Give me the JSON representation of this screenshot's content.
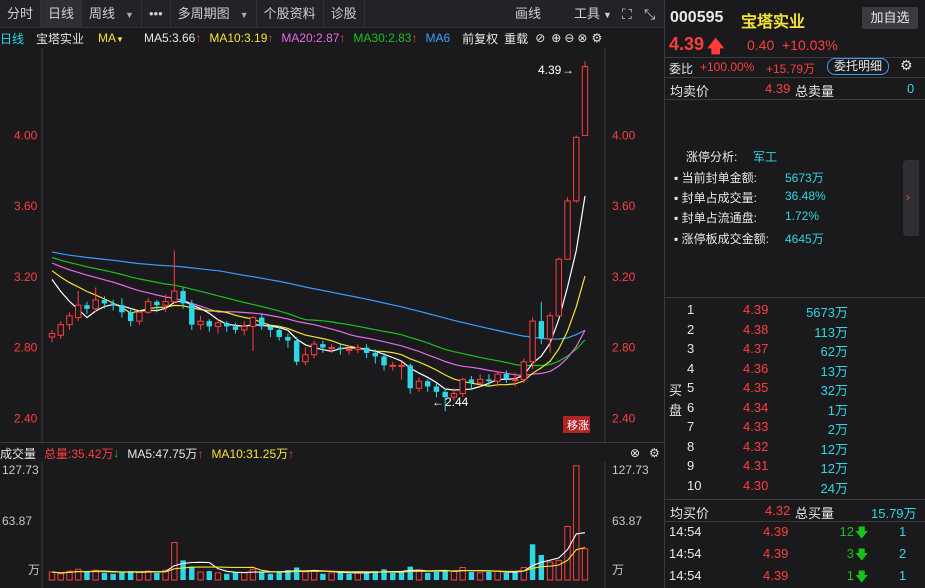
{
  "toolbar": {
    "items": [
      "分时",
      "日线",
      "周线",
      "•••",
      "多周期图",
      "个股资料",
      "诊股"
    ],
    "right_items": [
      "画线",
      "工具"
    ]
  },
  "chart_header": {
    "period": "日线",
    "name": "宝塔实业",
    "ma_label": "MA",
    "ma5": "MA5:3.66",
    "ma10": "MA10:3.19",
    "ma20": "MA20:2.87",
    "ma30": "MA30:2.83",
    "ma60": "MA6",
    "adjust": "前复权",
    "overlay": "重载"
  },
  "volume_header": {
    "label": "成交量",
    "total": "总量:35.42万",
    "ma5": "MA5:47.75万",
    "ma10": "MA10:31.25万"
  },
  "axis": {
    "price_ticks": [
      "4.00",
      "3.60",
      "3.20",
      "2.80",
      "2.40"
    ],
    "volume_ticks": [
      "127.73",
      "63.87"
    ],
    "volume_unit": "万"
  },
  "annotations": {
    "high": "4.39",
    "low": "2.44",
    "badge": "移涨"
  },
  "colors": {
    "up": "#ff3d3d",
    "down": "#2ed7e5",
    "ma5": "#ffffff",
    "ma10": "#f5e431",
    "ma20": "#e868e8",
    "ma30": "#19c219",
    "ma60": "#3d9bff"
  },
  "chart_data": {
    "type": "candlestick",
    "ylim": [
      2.3,
      4.45
    ],
    "candles": [
      [
        2.86,
        2.88,
        2.83,
        2.9
      ],
      [
        2.87,
        2.93,
        2.85,
        2.95
      ],
      [
        2.93,
        2.98,
        2.9,
        3.0
      ],
      [
        2.97,
        3.04,
        2.95,
        3.12
      ],
      [
        3.04,
        3.02,
        2.99,
        3.06
      ],
      [
        3.02,
        3.07,
        3.0,
        3.14
      ],
      [
        3.07,
        3.05,
        3.02,
        3.09
      ],
      [
        3.05,
        3.04,
        3.01,
        3.07
      ],
      [
        3.04,
        3.0,
        2.97,
        3.08
      ],
      [
        3.0,
        2.95,
        2.92,
        3.02
      ],
      [
        2.95,
        3.0,
        2.93,
        3.01
      ],
      [
        3.0,
        3.06,
        2.99,
        3.08
      ],
      [
        3.06,
        3.04,
        3.0,
        3.07
      ],
      [
        3.04,
        3.06,
        3.0,
        3.1
      ],
      [
        3.06,
        3.12,
        3.05,
        3.35
      ],
      [
        3.12,
        3.05,
        3.02,
        3.14
      ],
      [
        3.05,
        2.93,
        2.9,
        3.07
      ],
      [
        2.93,
        2.95,
        2.9,
        2.98
      ],
      [
        2.95,
        2.92,
        2.89,
        2.96
      ],
      [
        2.92,
        2.94,
        2.88,
        2.96
      ],
      [
        2.94,
        2.92,
        2.89,
        2.95
      ],
      [
        2.92,
        2.9,
        2.88,
        2.94
      ],
      [
        2.9,
        2.92,
        2.87,
        2.95
      ],
      [
        2.92,
        2.97,
        2.78,
        2.98
      ],
      [
        2.97,
        2.92,
        2.9,
        2.99
      ],
      [
        2.92,
        2.9,
        2.86,
        2.93
      ],
      [
        2.9,
        2.86,
        2.84,
        2.92
      ],
      [
        2.86,
        2.84,
        2.8,
        2.88
      ],
      [
        2.84,
        2.72,
        2.7,
        2.86
      ],
      [
        2.72,
        2.76,
        2.7,
        2.8
      ],
      [
        2.76,
        2.82,
        2.74,
        2.84
      ],
      [
        2.82,
        2.8,
        2.77,
        2.84
      ],
      [
        2.8,
        2.8,
        2.77,
        2.82
      ],
      [
        2.8,
        2.79,
        2.76,
        2.82
      ],
      [
        2.79,
        2.79,
        2.76,
        2.81
      ],
      [
        2.79,
        2.8,
        2.77,
        2.82
      ],
      [
        2.8,
        2.77,
        2.74,
        2.82
      ],
      [
        2.77,
        2.75,
        2.71,
        2.79
      ],
      [
        2.75,
        2.7,
        2.67,
        2.77
      ],
      [
        2.7,
        2.7,
        2.67,
        2.72
      ],
      [
        2.7,
        2.7,
        2.62,
        2.72
      ],
      [
        2.7,
        2.57,
        2.54,
        2.71
      ],
      [
        2.57,
        2.61,
        2.55,
        2.63
      ],
      [
        2.61,
        2.58,
        2.55,
        2.62
      ],
      [
        2.58,
        2.55,
        2.52,
        2.6
      ],
      [
        2.55,
        2.52,
        2.44,
        2.57
      ],
      [
        2.52,
        2.54,
        2.5,
        2.57
      ],
      [
        2.54,
        2.62,
        2.52,
        2.63
      ],
      [
        2.62,
        2.6,
        2.56,
        2.64
      ],
      [
        2.6,
        2.62,
        2.58,
        2.65
      ],
      [
        2.62,
        2.61,
        2.58,
        2.65
      ],
      [
        2.61,
        2.65,
        2.58,
        2.66
      ],
      [
        2.65,
        2.62,
        2.6,
        2.67
      ],
      [
        2.62,
        2.62,
        2.58,
        2.66
      ],
      [
        2.62,
        2.72,
        2.6,
        2.74
      ],
      [
        2.72,
        2.95,
        2.68,
        2.97
      ],
      [
        2.95,
        2.85,
        2.82,
        3.06
      ],
      [
        2.85,
        2.98,
        2.77,
        3.0
      ],
      [
        2.98,
        3.3,
        3.29,
        3.31
      ],
      [
        3.3,
        3.63,
        3.4,
        3.65
      ],
      [
        3.63,
        3.99,
        3.62,
        4.0
      ],
      [
        4.0,
        4.39,
        4.22,
        4.42
      ]
    ],
    "volumes": [
      [
        9,
        1
      ],
      [
        7,
        1
      ],
      [
        10,
        1
      ],
      [
        12,
        1
      ],
      [
        9,
        0
      ],
      [
        11,
        1
      ],
      [
        8,
        0
      ],
      [
        7,
        0
      ],
      [
        9,
        0
      ],
      [
        10,
        0
      ],
      [
        9,
        1
      ],
      [
        10,
        1
      ],
      [
        8,
        0
      ],
      [
        11,
        1
      ],
      [
        42,
        1
      ],
      [
        22,
        0
      ],
      [
        15,
        0
      ],
      [
        9,
        1
      ],
      [
        10,
        0
      ],
      [
        8,
        1
      ],
      [
        7,
        0
      ],
      [
        9,
        0
      ],
      [
        8,
        1
      ],
      [
        12,
        1
      ],
      [
        9,
        0
      ],
      [
        7,
        0
      ],
      [
        10,
        0
      ],
      [
        11,
        0
      ],
      [
        14,
        0
      ],
      [
        9,
        1
      ],
      [
        10,
        1
      ],
      [
        7,
        0
      ],
      [
        8,
        1
      ],
      [
        9,
        0
      ],
      [
        7,
        0
      ],
      [
        8,
        1
      ],
      [
        9,
        0
      ],
      [
        10,
        0
      ],
      [
        12,
        0
      ],
      [
        8,
        0
      ],
      [
        9,
        0
      ],
      [
        15,
        0
      ],
      [
        11,
        1
      ],
      [
        8,
        0
      ],
      [
        9,
        0
      ],
      [
        11,
        0
      ],
      [
        10,
        1
      ],
      [
        14,
        1
      ],
      [
        9,
        0
      ],
      [
        8,
        1
      ],
      [
        9,
        0
      ],
      [
        10,
        1
      ],
      [
        8,
        0
      ],
      [
        9,
        0
      ],
      [
        14,
        1
      ],
      [
        40,
        0
      ],
      [
        28,
        0
      ],
      [
        20,
        1
      ],
      [
        22,
        1
      ],
      [
        60,
        1
      ],
      [
        128,
        1
      ],
      [
        35,
        1
      ]
    ]
  },
  "stock": {
    "code": "000595",
    "name": "宝塔实业",
    "add_button": "加自选",
    "price": "4.39",
    "change": "0.40",
    "change_pct": "+10.03%",
    "weibi_label": "委比",
    "weibi_pct": "+100.00%",
    "weicha": "+15.79万",
    "weituo_button": "委托明细",
    "avg_sell_label": "均卖价",
    "avg_sell": "4.39",
    "total_sell_label": "总卖量",
    "total_sell": "0",
    "limit_info": {
      "title": "涨停分析:",
      "tag": "军工",
      "rows": [
        {
          "label": "当前封单金额:",
          "value": "5673万"
        },
        {
          "label": "封单占成交量:",
          "value": "36.48%"
        },
        {
          "label": "封单占流通盘:",
          "value": "1.72%"
        },
        {
          "label": "涨停板成交金额:",
          "value": "4645万"
        }
      ]
    },
    "buy_label_1": "买",
    "buy_label_2": "盘",
    "bids": [
      {
        "level": "1",
        "price": "4.39",
        "vol": "5673万"
      },
      {
        "level": "2",
        "price": "4.38",
        "vol": "113万"
      },
      {
        "level": "3",
        "price": "4.37",
        "vol": "62万"
      },
      {
        "level": "4",
        "price": "4.36",
        "vol": "13万"
      },
      {
        "level": "5",
        "price": "4.35",
        "vol": "32万"
      },
      {
        "level": "6",
        "price": "4.34",
        "vol": "1万"
      },
      {
        "level": "7",
        "price": "4.33",
        "vol": "2万"
      },
      {
        "level": "8",
        "price": "4.32",
        "vol": "12万"
      },
      {
        "level": "9",
        "price": "4.31",
        "vol": "12万"
      },
      {
        "level": "10",
        "price": "4.30",
        "vol": "24万"
      }
    ],
    "avg_buy_label": "均买价",
    "avg_buy": "4.32",
    "total_buy_label": "总买量",
    "total_buy": "15.79万",
    "trades": [
      {
        "time": "14:54",
        "price": "4.39",
        "vol": "12",
        "count": "1"
      },
      {
        "time": "14:54",
        "price": "4.39",
        "vol": "3",
        "count": "2"
      },
      {
        "time": "14:54",
        "price": "4.39",
        "vol": "1",
        "count": "1"
      }
    ]
  }
}
